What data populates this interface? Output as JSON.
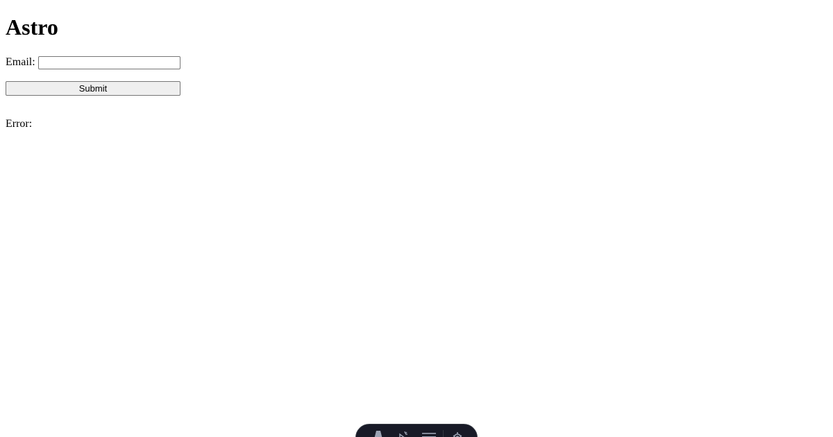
{
  "header": {
    "title": "Astro"
  },
  "form": {
    "email_label": "Email:",
    "email_value": "",
    "email_placeholder": "",
    "submit_label": "Submit"
  },
  "status": {
    "error_label": "Error:"
  },
  "dev_toolbar": {
    "items": [
      {
        "icon": "astro-logo-icon"
      },
      {
        "icon": "cursor-sparkle-icon"
      },
      {
        "icon": "menu-lines-icon"
      },
      {
        "icon": "gear-icon"
      }
    ],
    "background": "#181a27",
    "icon_color": "#9ca3b4"
  }
}
